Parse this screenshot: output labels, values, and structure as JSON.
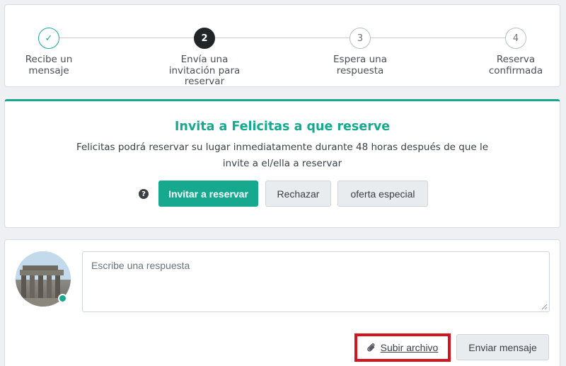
{
  "stepper": {
    "steps": [
      {
        "number": "✓",
        "label_line1": "Recibe un",
        "label_line2": "mensaje",
        "label_line3": "",
        "state": "done"
      },
      {
        "number": "2",
        "label_line1": "Envía una",
        "label_line2": "invitación para",
        "label_line3": "reservar",
        "state": "active"
      },
      {
        "number": "3",
        "label_line1": "Espera una",
        "label_line2": "respuesta",
        "label_line3": "",
        "state": "pending"
      },
      {
        "number": "4",
        "label_line1": "Reserva",
        "label_line2": "confirmada",
        "label_line3": "",
        "state": "pending"
      }
    ]
  },
  "invite": {
    "title": "Invita a Felicitas a que reserve",
    "description_line1": "Felicitas podrá reservar su lugar inmediatamente durante 48 horas después de que le",
    "description_line2": "invite a el/ella a reservar",
    "help_icon": "question-circle-icon",
    "invite_button": "Invitar a reservar",
    "decline_button": "Rechazar",
    "special_offer_button": "oferta especial"
  },
  "reply": {
    "placeholder": "Escribe una respuesta",
    "value": "",
    "upload_icon": "paperclip-icon",
    "upload_label": "Subir archivo",
    "send_button": "Enviar mensaje",
    "online_status": "online"
  },
  "colors": {
    "accent": "#17a98f",
    "highlight_border": "#d3141b",
    "background": "#eef0f3"
  }
}
